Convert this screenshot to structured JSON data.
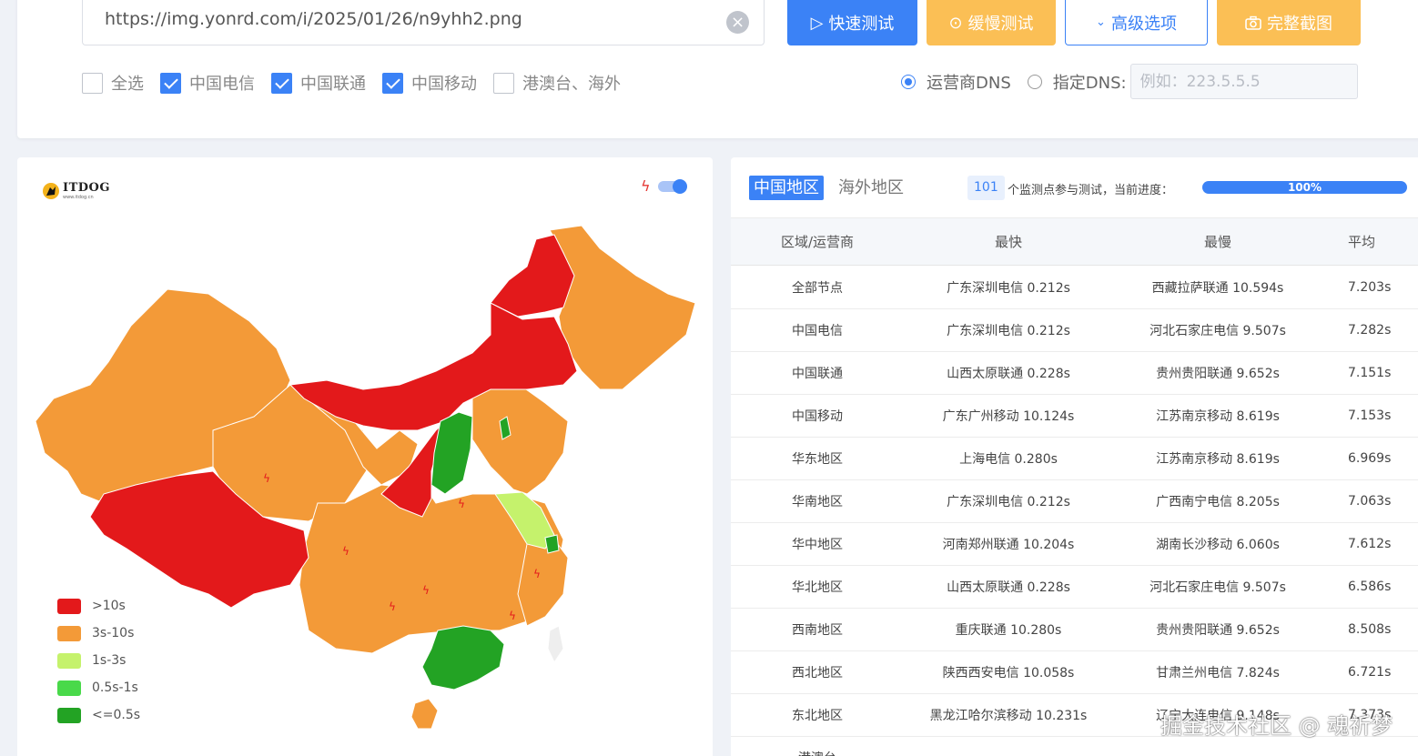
{
  "toolbar": {
    "url_value": "https://img.yonrd.com/i/2025/01/26/n9yhh2.png",
    "clear_icon": "close-circle-icon",
    "quick_test_label": "快速测试",
    "slow_test_label": "缓慢测试",
    "advanced_label": "高级选项",
    "screenshot_label": "完整截图"
  },
  "filters": {
    "options": [
      {
        "label": "全选",
        "checked": false
      },
      {
        "label": "中国电信",
        "checked": true
      },
      {
        "label": "中国联通",
        "checked": true
      },
      {
        "label": "中国移动",
        "checked": true
      },
      {
        "label": "港澳台、海外",
        "checked": false
      }
    ],
    "dns_carrier_label": "运营商DNS",
    "dns_custom_label": "指定DNS:",
    "dns_selected": "运营商DNS",
    "dns_placeholder": "例如：223.5.5.5"
  },
  "map": {
    "logo_text": "ITDOG",
    "logo_subtext": "www.itdog.cn",
    "legend": [
      {
        "label": ">10s",
        "color": "#e3191b"
      },
      {
        "label": "3s-10s",
        "color": "#f39a38"
      },
      {
        "label": "1s-3s",
        "color": "#c5f26c"
      },
      {
        "label": "0.5s-1s",
        "color": "#49d94a"
      },
      {
        "label": "<=0.5s",
        "color": "#23a324"
      }
    ]
  },
  "results": {
    "tabs": [
      "中国地区",
      "海外地区"
    ],
    "active_tab": "中国地区",
    "node_count": "101",
    "count_text": "个监测点参与测试，当前进度：",
    "progress": "100%",
    "headers": [
      "区域/运营商",
      "最快",
      "最慢",
      "平均"
    ],
    "rows": [
      {
        "region": "全部节点",
        "fastest": "广东深圳电信 0.212s",
        "slowest": "西藏拉萨联通 10.594s",
        "average": "7.203s"
      },
      {
        "region": "中国电信",
        "fastest": "广东深圳电信 0.212s",
        "slowest": "河北石家庄电信 9.507s",
        "average": "7.282s"
      },
      {
        "region": "中国联通",
        "fastest": "山西太原联通 0.228s",
        "slowest": "贵州贵阳联通 9.652s",
        "average": "7.151s"
      },
      {
        "region": "中国移动",
        "fastest": "广东广州移动 10.124s",
        "slowest": "江苏南京移动 8.619s",
        "average": "7.153s"
      },
      {
        "region": "华东地区",
        "fastest": "上海电信 0.280s",
        "slowest": "江苏南京移动 8.619s",
        "average": "6.969s"
      },
      {
        "region": "华南地区",
        "fastest": "广东深圳电信 0.212s",
        "slowest": "广西南宁电信 8.205s",
        "average": "7.063s"
      },
      {
        "region": "华中地区",
        "fastest": "河南郑州联通 10.204s",
        "slowest": "湖南长沙移动 6.060s",
        "average": "7.612s"
      },
      {
        "region": "华北地区",
        "fastest": "山西太原联通 0.228s",
        "slowest": "河北石家庄电信 9.507s",
        "average": "6.586s"
      },
      {
        "region": "西南地区",
        "fastest": "重庆联通 10.280s",
        "slowest": "贵州贵阳联通 9.652s",
        "average": "8.508s"
      },
      {
        "region": "西北地区",
        "fastest": "陕西西安电信 10.058s",
        "slowest": "甘肃兰州电信 7.824s",
        "average": "6.721s"
      },
      {
        "region": "东北地区",
        "fastest": "黑龙江哈尔滨移动 10.231s",
        "slowest": "辽宁大连电信 9.148s",
        "average": "7.373s"
      },
      {
        "region": "港澳台",
        "fastest": "",
        "slowest": "",
        "average": ""
      }
    ]
  },
  "watermark": "掘金技术社区 @ 魂祈梦"
}
